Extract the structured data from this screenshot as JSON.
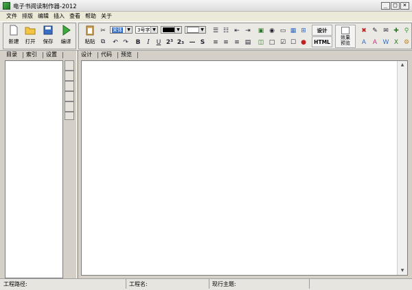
{
  "window": {
    "title": "电子书阅读制作器-2012",
    "min": "_",
    "max": "□",
    "close": "×"
  },
  "menu": [
    "文件",
    "排版",
    "编辑",
    "插入",
    "查看",
    "帮助",
    "关于"
  ],
  "file_buttons": [
    {
      "label": "新建",
      "icon": "new-file-icon"
    },
    {
      "label": "打开",
      "icon": "folder-open-icon"
    },
    {
      "label": "保存",
      "icon": "save-disk-icon"
    },
    {
      "label": "编译",
      "icon": "play-triangle-icon"
    }
  ],
  "paste": {
    "label": "粘贴"
  },
  "font": {
    "name": "宋体",
    "size": "3号字"
  },
  "format_buttons": {
    "bold": "B",
    "italic": "I",
    "underline": "U",
    "superscript": "2³",
    "subscript": "2₃",
    "hr": "—",
    "strike": "S"
  },
  "design_button": "设计",
  "html_button": "HTML",
  "preview_button": "效果预览",
  "left_tabs": [
    "目录",
    "索引",
    "设置"
  ],
  "editor_tabs": [
    "设计",
    "代码",
    "预览"
  ],
  "status": {
    "path_label": "工程路径:",
    "name_label": "工程名:",
    "theme_label": "现行主题:"
  },
  "colors": {
    "accent": "#316ac5",
    "toolbar": "#e8e6e0"
  }
}
